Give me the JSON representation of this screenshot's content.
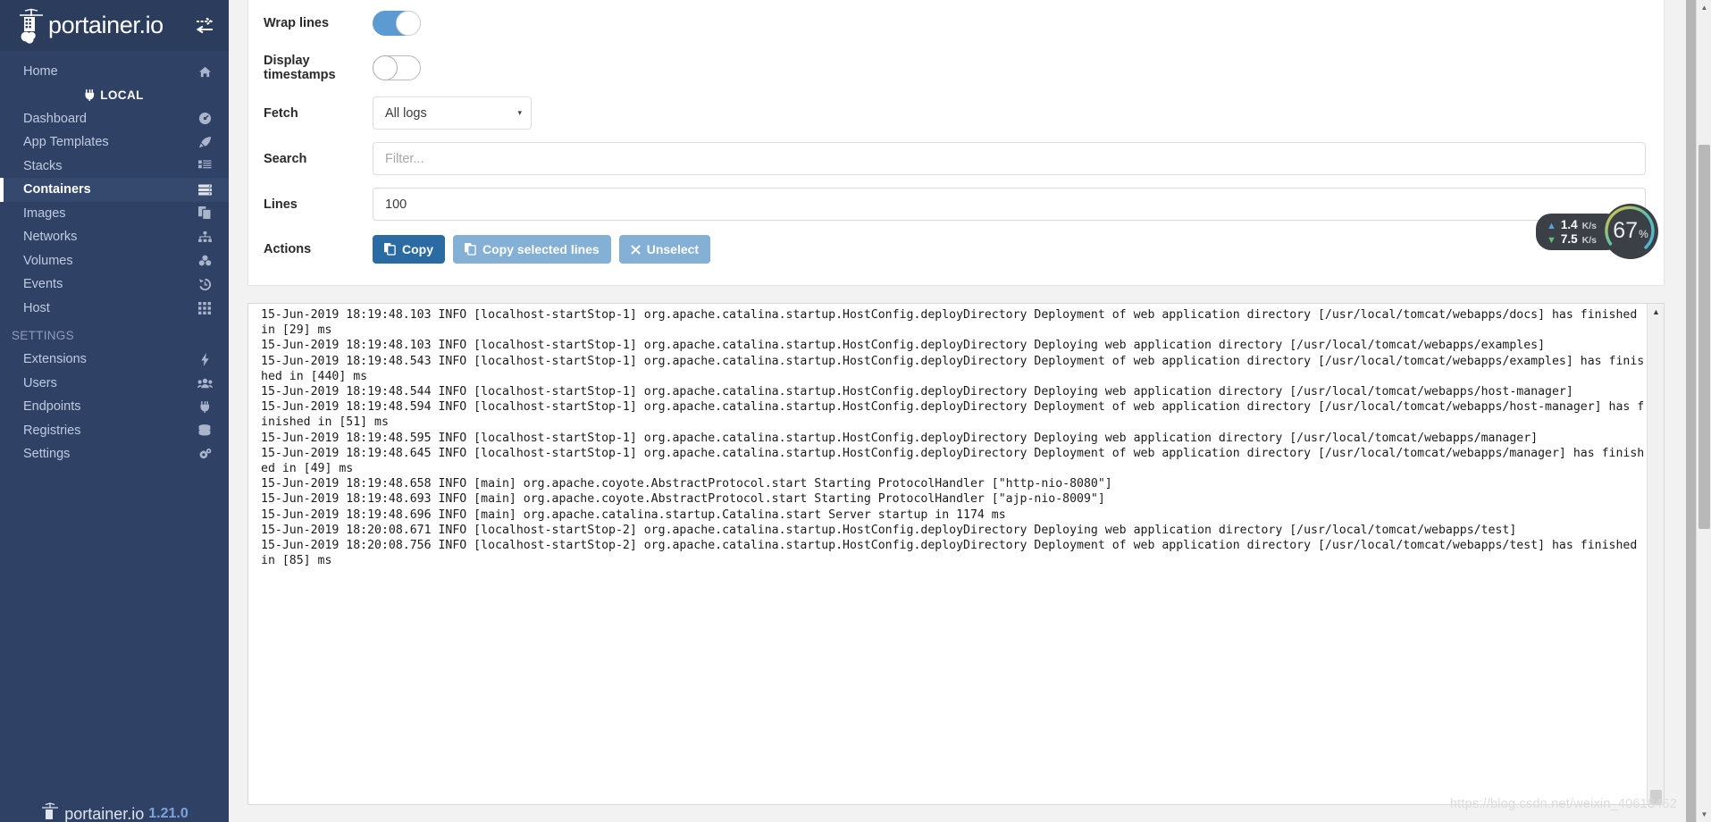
{
  "sidebar": {
    "brand": "portainer.io",
    "toggle_icon": "toggle-sidebar-icon",
    "home": {
      "label": "Home",
      "icon": "home-icon"
    },
    "endpoint": {
      "label": "LOCAL",
      "icon": "plug-icon"
    },
    "items": [
      {
        "label": "Dashboard",
        "icon": "dashboard-icon",
        "active": false
      },
      {
        "label": "App Templates",
        "icon": "rocket-icon",
        "active": false
      },
      {
        "label": "Stacks",
        "icon": "list-icon",
        "active": false
      },
      {
        "label": "Containers",
        "icon": "server-icon",
        "active": true
      },
      {
        "label": "Images",
        "icon": "copy-icon",
        "active": false
      },
      {
        "label": "Networks",
        "icon": "sitemap-icon",
        "active": false
      },
      {
        "label": "Volumes",
        "icon": "cubes-icon",
        "active": false
      },
      {
        "label": "Events",
        "icon": "history-icon",
        "active": false
      },
      {
        "label": "Host",
        "icon": "grid-icon",
        "active": false
      }
    ],
    "settings_title": "SETTINGS",
    "settings_items": [
      {
        "label": "Extensions",
        "icon": "bolt-icon",
        "active": false
      },
      {
        "label": "Users",
        "icon": "users-icon",
        "active": false
      },
      {
        "label": "Endpoints",
        "icon": "plug-icon",
        "active": false
      },
      {
        "label": "Registries",
        "icon": "database-icon",
        "active": false
      },
      {
        "label": "Settings",
        "icon": "gears-icon",
        "active": false
      }
    ],
    "footer": {
      "brand": "portainer.io",
      "version": "1.21.0"
    }
  },
  "controls": {
    "wrap_lines": {
      "label": "Wrap lines",
      "value": "on"
    },
    "display_timestamps": {
      "label": "Display timestamps",
      "value": "off"
    },
    "fetch": {
      "label": "Fetch",
      "value": "All logs",
      "caret": "▾"
    },
    "search": {
      "label": "Search",
      "value": "",
      "placeholder": "Filter..."
    },
    "lines": {
      "label": "Lines",
      "value": "100"
    },
    "actions": {
      "label": "Actions",
      "buttons": [
        {
          "label": "Copy",
          "icon": "copy-icon",
          "style": "primary"
        },
        {
          "label": "Copy selected lines",
          "icon": "copy-icon",
          "style": "muted"
        },
        {
          "label": "Unselect",
          "icon": "times-icon",
          "style": "muted"
        }
      ]
    }
  },
  "logs": {
    "lines": [
      "15-Jun-2019 18:19:48.103 INFO [localhost-startStop-1] org.apache.catalina.startup.HostConfig.deployDirectory Deployment of web application directory [/usr/local/tomcat/webapps/docs] has finished in [29] ms",
      "15-Jun-2019 18:19:48.103 INFO [localhost-startStop-1] org.apache.catalina.startup.HostConfig.deployDirectory Deploying web application directory [/usr/local/tomcat/webapps/examples]",
      "15-Jun-2019 18:19:48.543 INFO [localhost-startStop-1] org.apache.catalina.startup.HostConfig.deployDirectory Deployment of web application directory [/usr/local/tomcat/webapps/examples] has finished in [440] ms",
      "15-Jun-2019 18:19:48.544 INFO [localhost-startStop-1] org.apache.catalina.startup.HostConfig.deployDirectory Deploying web application directory [/usr/local/tomcat/webapps/host-manager]",
      "15-Jun-2019 18:19:48.594 INFO [localhost-startStop-1] org.apache.catalina.startup.HostConfig.deployDirectory Deployment of web application directory [/usr/local/tomcat/webapps/host-manager] has finished in [51] ms",
      "15-Jun-2019 18:19:48.595 INFO [localhost-startStop-1] org.apache.catalina.startup.HostConfig.deployDirectory Deploying web application directory [/usr/local/tomcat/webapps/manager]",
      "15-Jun-2019 18:19:48.645 INFO [localhost-startStop-1] org.apache.catalina.startup.HostConfig.deployDirectory Deployment of web application directory [/usr/local/tomcat/webapps/manager] has finished in [49] ms",
      "15-Jun-2019 18:19:48.658 INFO [main] org.apache.coyote.AbstractProtocol.start Starting ProtocolHandler [\"http-nio-8080\"]",
      "15-Jun-2019 18:19:48.693 INFO [main] org.apache.coyote.AbstractProtocol.start Starting ProtocolHandler [\"ajp-nio-8009\"]",
      "15-Jun-2019 18:19:48.696 INFO [main] org.apache.catalina.startup.Catalina.start Server startup in 1174 ms",
      "15-Jun-2019 18:20:08.671 INFO [localhost-startStop-2] org.apache.catalina.startup.HostConfig.deployDirectory Deploying web application directory [/usr/local/tomcat/webapps/test]",
      "15-Jun-2019 18:20:08.756 INFO [localhost-startStop-2] org.apache.catalina.startup.HostConfig.deployDirectory Deployment of web application directory [/usr/local/tomcat/webapps/test] has finished in [85] ms"
    ]
  },
  "network_widget": {
    "upload": {
      "value": "1.4",
      "unit": "K/s",
      "arrow": "▲",
      "color": "#5d9fd6"
    },
    "download": {
      "value": "7.5",
      "unit": "K/s",
      "arrow": "▼",
      "color": "#63c07a"
    },
    "gauge": {
      "value": "67",
      "unit": "%"
    }
  },
  "watermark": "https://blog.csdn.net/weixin_40618452",
  "colors": {
    "sidebar_bg": "#2f4266",
    "sidebar_active": "#35486e",
    "primary_button": "#2b6ba3",
    "muted_button": "#85b0d5",
    "toggle_on": "#5b9bd1"
  }
}
